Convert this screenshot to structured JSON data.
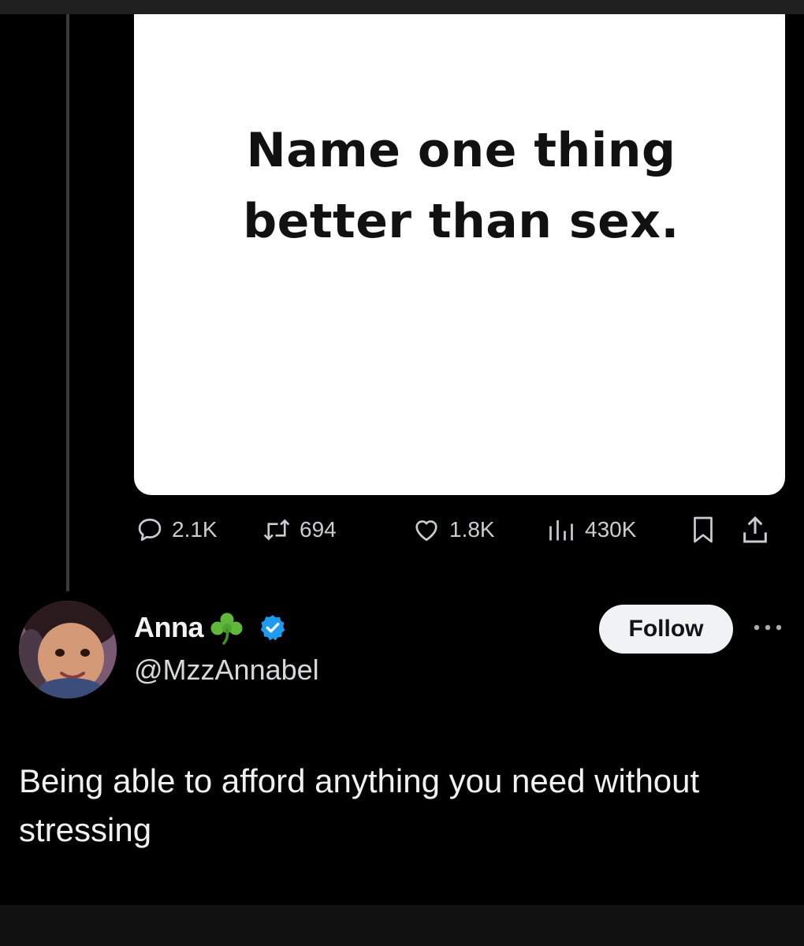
{
  "quoted_post": {
    "image_text": "Name one thing better than sex."
  },
  "actions": {
    "reply_count": "2.1K",
    "repost_count": "694",
    "like_count": "1.8K",
    "view_count": "430K"
  },
  "reply": {
    "author_name": "Anna",
    "handle": "@MzzAnnabel",
    "follow_label": "Follow",
    "text": "Being able to afford anything you need without stressing"
  },
  "icons": {
    "reply": "speech-bubble-icon",
    "repost": "repost-arrows-icon",
    "like": "heart-icon",
    "views": "bar-chart-icon",
    "bookmark": "bookmark-icon",
    "share": "share-upload-icon",
    "more": "ellipsis-icon",
    "verified": "verified-badge-icon",
    "emoji": "shamrock-emoji"
  },
  "colors": {
    "background": "#000000",
    "verified_badge": "#1d9bf0",
    "text_primary": "#e7e9ea",
    "follow_button_bg": "#eff3f4"
  }
}
